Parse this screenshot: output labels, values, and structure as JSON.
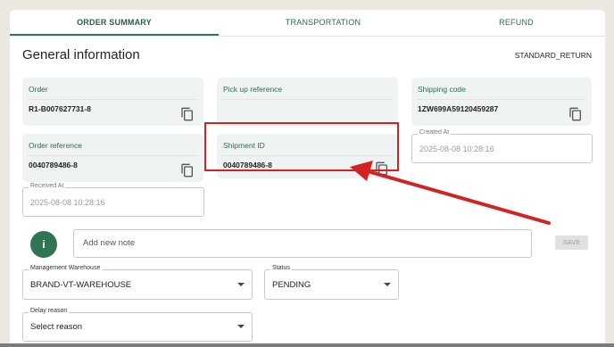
{
  "tabs": [
    {
      "label": "ORDER SUMMARY",
      "active": true
    },
    {
      "label": "TRANSPORTATION",
      "active": false
    },
    {
      "label": "REFUND",
      "active": false
    }
  ],
  "section": {
    "title": "General information",
    "return_type": "STANDARD_RETURN"
  },
  "fields": {
    "order": {
      "label": "Order",
      "value": "R1-B007627731-8"
    },
    "pickup_reference": {
      "label": "Pick up reference",
      "value": ""
    },
    "shipping_code": {
      "label": "Shipping code",
      "value": "1ZW699A59120459287"
    },
    "order_reference": {
      "label": "Order reference",
      "value": "0040789486-8"
    },
    "shipment_id": {
      "label": "Shipment ID",
      "value": "0040789486-8"
    },
    "created_at": {
      "label": "Created At",
      "value": "2025-08-08 10:28:16"
    },
    "received_at": {
      "label": "Received At",
      "value": "2025-08-08 10:28:16"
    }
  },
  "note": {
    "avatar_letter": "i",
    "placeholder": "Add new note",
    "save_label": "SAVE"
  },
  "selects": {
    "management_warehouse": {
      "label": "Management Warehouse",
      "value": "BRAND-VT-WAREHOUSE"
    },
    "status": {
      "label": "Status",
      "value": "PENDING"
    },
    "delay_reason": {
      "label": "Delay reason",
      "value": "Select reason"
    }
  },
  "colors": {
    "accent": "#2f7553",
    "annotation": "#d42222"
  },
  "icons": {
    "copy": "copy-icon",
    "dropdown": "chevron-down-icon"
  }
}
